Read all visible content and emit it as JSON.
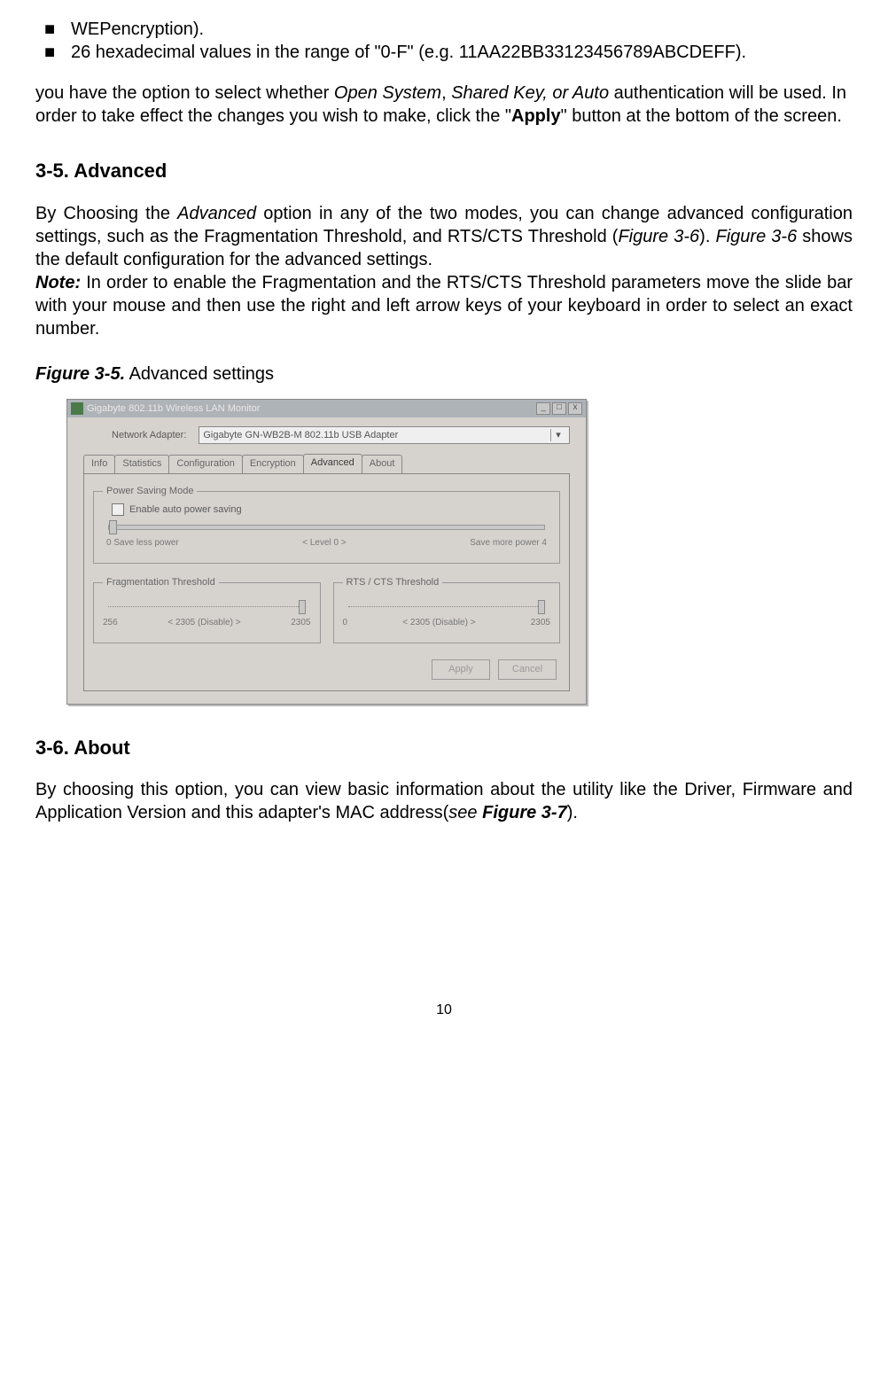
{
  "top": {
    "frag0": "WEPencryption).",
    "bullet1": "26 hexadecimal values in the range of \"0-F\" (e.g. 11AA22BB33123456789ABCDEFF).",
    "authPara_a": "you have the option to select whether ",
    "authPara_italic": "Open System",
    "authPara_b": ", ",
    "authPara_italic2": "Shared Key, or Auto",
    "authPara_c": " authentication will be used. In order to take effect the changes you wish to make, click the \"",
    "authPara_bold": "Apply",
    "authPara_d": "\" button at the bottom of the screen."
  },
  "sec35": {
    "heading": "3-5.   Advanced",
    "p_a": "By Choosing the ",
    "p_it1": "Advanced",
    "p_b": " option in any of the two modes, you can change advanced configuration settings, such as the Fragmentation Threshold, and RTS/CTS Threshold (",
    "p_it2": "Figure 3-6",
    "p_c": "). ",
    "p_it3": "Figure 3-6",
    "p_d": " shows the default configuration for the advanced settings.",
    "note_label": "Note:",
    "note_body": " In order to enable the Fragmentation and the RTS/CTS Threshold parameters move the slide bar with your mouse and then use the right and left arrow keys of your keyboard in order to select an exact number."
  },
  "figcap": {
    "label": "Figure 3-5.",
    "text": "   Advanced settings"
  },
  "win": {
    "title": "Gigabyte 802.11b Wireless LAN Monitor",
    "adapter_label": "Network Adapter:",
    "adapter_value": "Gigabyte GN-WB2B-M 802.11b USB Adapter",
    "tabs": {
      "info": "Info",
      "stats": "Statistics",
      "config": "Configuration",
      "enc": "Encryption",
      "adv": "Advanced",
      "about": "About"
    },
    "psm": {
      "legend": "Power Saving Mode",
      "checkbox": "Enable auto power saving",
      "scale_left": "0  Save less power",
      "scale_mid": "< Level 0 >",
      "scale_right": "Save more power  4"
    },
    "frag": {
      "legend": "Fragmentation Threshold",
      "min": "256",
      "mid": "< 2305 (Disable) >",
      "max": "2305"
    },
    "rts": {
      "legend": "RTS / CTS Threshold",
      "min": "0",
      "mid": "< 2305 (Disable) >",
      "max": "2305"
    },
    "btn_apply": "Apply",
    "btn_cancel": "Cancel"
  },
  "sec36": {
    "heading": "3-6.   About",
    "p_a": "By choosing this option, you can view basic information about the utility like the Driver, Firmware and Application Version and this adapter's MAC address(",
    "p_it": "see ",
    "p_bold": "Figure 3-7",
    "p_b": ")."
  },
  "page_number": "10"
}
